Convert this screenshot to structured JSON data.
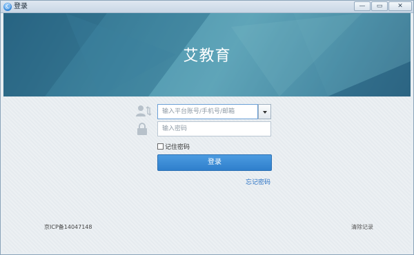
{
  "window": {
    "title": "登录",
    "app_icon_glyph": "Ⓒ"
  },
  "window_controls": {
    "minimize": "—",
    "maximize": "▭",
    "close": "✕"
  },
  "banner": {
    "brand": "艾教育",
    "accent": "#4a92ab"
  },
  "form": {
    "account_placeholder": "输入平台账号/手机号/邮箱",
    "password_placeholder": "输入密码",
    "remember_label": "记住密码",
    "remember_checked": false,
    "login_label": "登录",
    "forgot_label": "忘记密码"
  },
  "footer": {
    "icp": "京ICP备14047148",
    "clear_label": "清除记录"
  },
  "colors": {
    "button": "#3a8ad6",
    "link": "#2a72c4"
  }
}
